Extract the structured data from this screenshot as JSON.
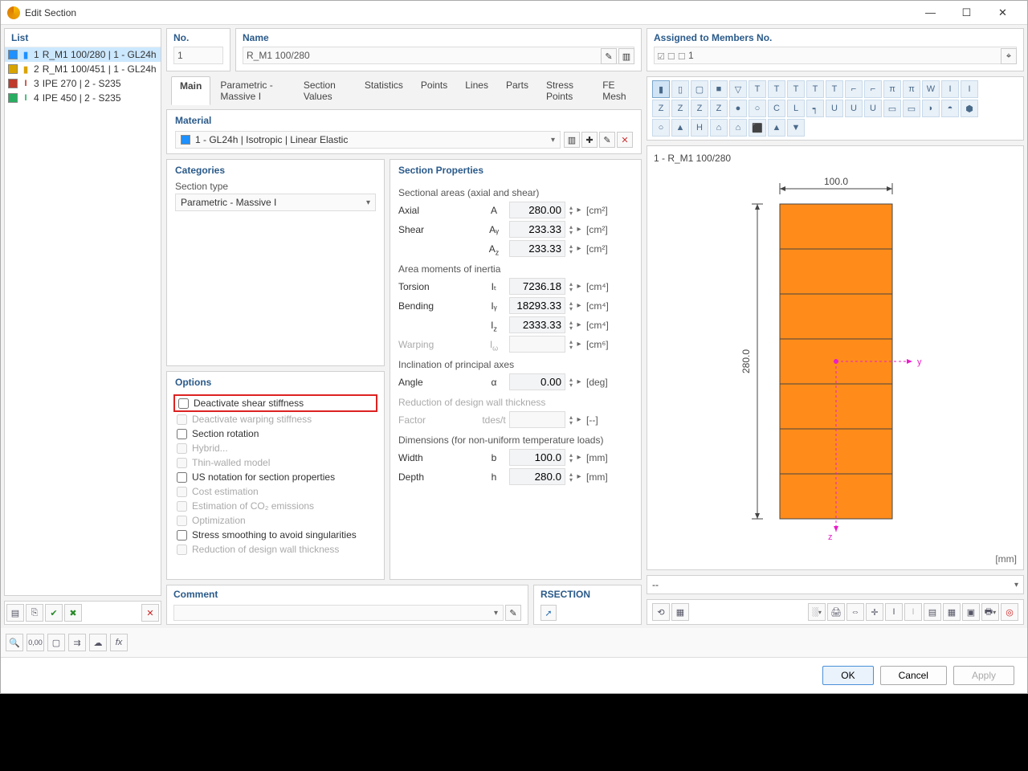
{
  "title": "Edit Section",
  "left": {
    "header": "List",
    "items": [
      {
        "idx": "1",
        "name": "R_M1 100/280 | 1 - GL24h",
        "sel": true,
        "color": "#1e90ff",
        "shape": "rect"
      },
      {
        "idx": "2",
        "name": "R_M1 100/451 | 1 - GL24h",
        "sel": false,
        "color": "#d9a400",
        "shape": "rect"
      },
      {
        "idx": "3",
        "name": "IPE 270 | 2 - S235",
        "sel": false,
        "color": "#c0392b",
        "shape": "I"
      },
      {
        "idx": "4",
        "name": "IPE 450 | 2 - S235",
        "sel": false,
        "color": "#27ae60",
        "shape": "I"
      }
    ]
  },
  "top": {
    "no_label": "No.",
    "no_val": "1",
    "name_label": "Name",
    "name_val": "R_M1 100/280",
    "assigned_label": "Assigned to Members No.",
    "assigned_val": "1"
  },
  "tabs": [
    "Main",
    "Parametric - Massive I",
    "Section Values",
    "Statistics",
    "Points",
    "Lines",
    "Parts",
    "Stress Points",
    "FE Mesh"
  ],
  "material": {
    "header": "Material",
    "value": "1 - GL24h | Isotropic | Linear Elastic",
    "color": "#1e90ff"
  },
  "categories": {
    "header": "Categories",
    "section_type_label": "Section type",
    "section_type_value": "Parametric - Massive I"
  },
  "options": {
    "header": "Options",
    "items": [
      {
        "label": "Deactivate shear stiffness",
        "checked": false,
        "disabled": false,
        "hl": true
      },
      {
        "label": "Deactivate warping stiffness",
        "checked": false,
        "disabled": true,
        "hl": false
      },
      {
        "label": "Section rotation",
        "checked": false,
        "disabled": false,
        "hl": false
      },
      {
        "label": "Hybrid...",
        "checked": false,
        "disabled": true,
        "hl": false
      },
      {
        "label": "Thin-walled model",
        "checked": false,
        "disabled": true,
        "hl": false
      },
      {
        "label": "US notation for section properties",
        "checked": false,
        "disabled": false,
        "hl": false
      },
      {
        "label": "Cost estimation",
        "checked": false,
        "disabled": true,
        "hl": false
      },
      {
        "label": "Estimation of CO₂ emissions",
        "checked": false,
        "disabled": true,
        "hl": false
      },
      {
        "label": "Optimization",
        "checked": false,
        "disabled": true,
        "hl": false
      },
      {
        "label": "Stress smoothing to avoid singularities",
        "checked": false,
        "disabled": false,
        "hl": false
      },
      {
        "label": "Reduction of design wall thickness",
        "checked": false,
        "disabled": true,
        "hl": false
      }
    ]
  },
  "props": {
    "header": "Section Properties",
    "groups": [
      {
        "title": "Sectional areas (axial and shear)",
        "rows": [
          {
            "name": "Axial",
            "sym": "A",
            "val": "280.00",
            "unit": "[cm²]"
          },
          {
            "name": "Shear",
            "sym": "Aᵧ",
            "val": "233.33",
            "unit": "[cm²]"
          },
          {
            "name": "",
            "sym": "A_z",
            "val": "233.33",
            "unit": "[cm²]"
          }
        ]
      },
      {
        "title": "Area moments of inertia",
        "rows": [
          {
            "name": "Torsion",
            "sym": "Iₜ",
            "val": "7236.18",
            "unit": "[cm⁴]"
          },
          {
            "name": "Bending",
            "sym": "Iᵧ",
            "val": "18293.33",
            "unit": "[cm⁴]"
          },
          {
            "name": "",
            "sym": "I_z",
            "val": "2333.33",
            "unit": "[cm⁴]"
          },
          {
            "name": "Warping",
            "sym": "I_ω",
            "val": "",
            "unit": "[cm⁶]",
            "dim": true
          }
        ]
      },
      {
        "title": "Inclination of principal axes",
        "rows": [
          {
            "name": "Angle",
            "sym": "α",
            "val": "0.00",
            "unit": "[deg]"
          }
        ]
      },
      {
        "title": "Reduction of design wall thickness",
        "dim": true,
        "rows": [
          {
            "name": "Factor",
            "sym": "tdes/t",
            "val": "",
            "unit": "[--]",
            "dim": true
          }
        ]
      },
      {
        "title": "Dimensions (for non-uniform temperature loads)",
        "rows": [
          {
            "name": "Width",
            "sym": "b",
            "val": "100.0",
            "unit": "[mm]"
          },
          {
            "name": "Depth",
            "sym": "h",
            "val": "280.0",
            "unit": "[mm]"
          }
        ]
      }
    ]
  },
  "preview": {
    "title": "1 - R_M1 100/280",
    "dim_w": "100.0",
    "dim_h": "280.0",
    "unit": "[mm]",
    "y": "y",
    "z": "z"
  },
  "comment": {
    "header": "Comment"
  },
  "rsection": {
    "header": "RSECTION"
  },
  "buttons": {
    "ok": "OK",
    "cancel": "Cancel",
    "apply": "Apply"
  }
}
